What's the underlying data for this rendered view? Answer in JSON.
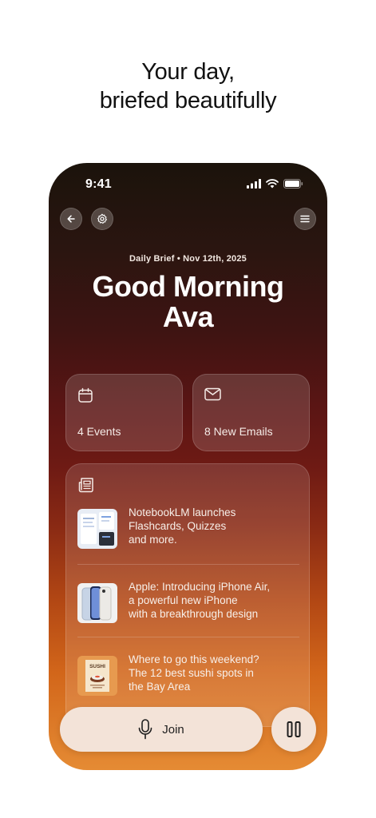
{
  "headline": {
    "line1": "Your day,",
    "line2": "briefed beautifully"
  },
  "status_bar": {
    "time": "9:41"
  },
  "toolbar": {
    "back_icon": "arrow-left-icon",
    "settings_icon": "gear-icon",
    "menu_icon": "hamburger-menu-icon"
  },
  "brief": {
    "subtitle": "Daily Brief • Nov 12th, 2025",
    "greeting_line1": "Good Morning",
    "greeting_line2": "Ava"
  },
  "cards": {
    "events": {
      "icon": "calendar-icon",
      "label": "4 Events"
    },
    "emails": {
      "icon": "mail-icon",
      "label": "8 New Emails"
    }
  },
  "news": {
    "icon": "newspaper-icon",
    "items": [
      {
        "lines": [
          "NotebookLM launches",
          "Flashcards, Quizzes",
          "and more."
        ]
      },
      {
        "lines": [
          "Apple: Introducing iPhone Air,",
          "a powerful new iPhone",
          "with a breakthrough design"
        ]
      },
      {
        "lines": [
          "Where to go this weekend?",
          "The 12 best sushi spots in",
          "the Bay Area"
        ],
        "thumb_text": "SUSHI"
      }
    ]
  },
  "controls": {
    "join_label": "Join",
    "mic_icon": "microphone-icon",
    "pause_icon": "pause-icon"
  },
  "colors": {
    "gradient_top": "#1b130b",
    "gradient_mid": "#6e1a14",
    "gradient_bottom": "#e58b34",
    "button_bg": "#f3e3d8"
  }
}
